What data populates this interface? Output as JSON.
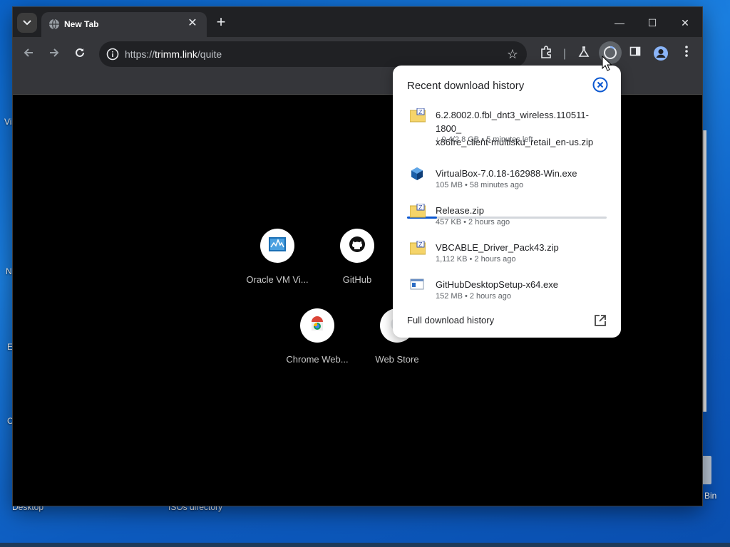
{
  "desktop": {
    "labels": [
      "Desktop",
      "ISOs directory",
      "Bin"
    ],
    "fragments": [
      "Vis",
      "N",
      "E",
      "C"
    ]
  },
  "browser": {
    "tab": {
      "title": "New Tab",
      "close": "✕"
    },
    "new_tab": "+",
    "window_controls": {
      "minimize": "—",
      "maximize": "☐",
      "close": "✕"
    },
    "omnibox": {
      "url_prefix": "https://",
      "url_host": "trimm.link",
      "url_path": "/quite"
    },
    "shortcuts": [
      {
        "label": "Oracle VM Vi...",
        "icon": "virtualbox-icon"
      },
      {
        "label": "GitHub",
        "icon": "github-icon"
      },
      {
        "label": "Chrome Web...",
        "icon": "chrome-web-store-icon"
      },
      {
        "label": "Web Store",
        "icon": "web-store-icon"
      }
    ]
  },
  "downloads": {
    "title": "Recent download history",
    "items": [
      {
        "name_line1": "6.2.8002.0.fbl_dnt3_wireless.110511-1800_",
        "name_line2": "x86fre_client-multisku_retail_en-us.zip",
        "meta": "↓ 0.4/2.8 GB • 5 minutes left",
        "progress": 0.15,
        "icon": "zip-folder-icon"
      },
      {
        "name": "VirtualBox-7.0.18-162988-Win.exe",
        "meta": "105 MB • 58 minutes ago",
        "icon": "virtualbox-installer-icon"
      },
      {
        "name": "Release.zip",
        "meta": "457 KB • 2 hours ago",
        "icon": "zip-folder-icon"
      },
      {
        "name": "VBCABLE_Driver_Pack43.zip",
        "meta": "1,112 KB • 2 hours ago",
        "icon": "zip-folder-icon"
      },
      {
        "name": "GitHubDesktopSetup-x64.exe",
        "meta": "152 MB • 2 hours ago",
        "icon": "exe-window-icon"
      }
    ],
    "full_history": "Full download history"
  },
  "colors": {
    "accent": "#0b57d0",
    "toolbar": "#35363a",
    "tabstrip": "#202124"
  }
}
